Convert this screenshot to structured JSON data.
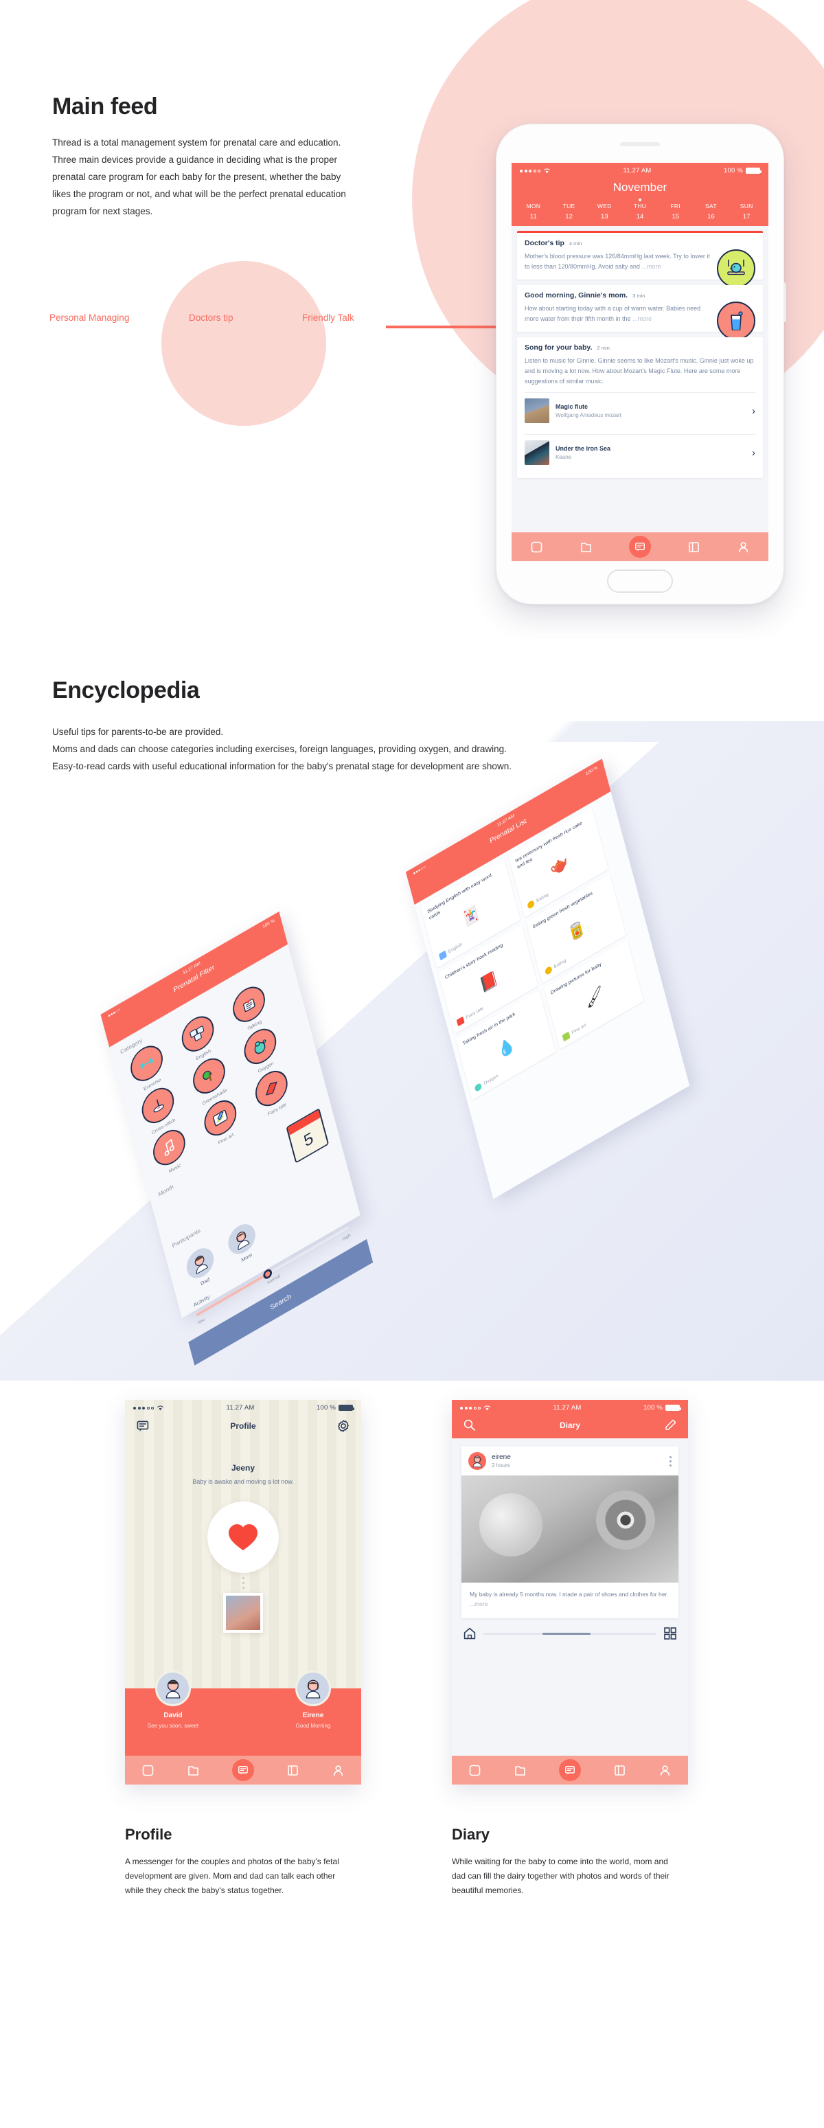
{
  "sections": {
    "main": {
      "title": "Main feed",
      "paragraph": "Thread is a total management system for prenatal care and education.\nThree main devices provide a guidance in deciding what is the proper\nprenatal care program for each baby for the present, whether the baby\n likes the program or not, and what will be the perfect prenatal education\nprogram for next stages.",
      "tags": [
        "Personal Managing",
        "Doctors tip",
        "Friendly Talk"
      ]
    },
    "encyclopedia": {
      "title": "Encyclopedia",
      "lines": [
        "Useful tips for parents-to-be are provided.",
        "Moms and dads can choose categories including exercises, foreign languages, providing oxygen, and drawing.",
        "Easy-to-read cards with useful educational information for the baby's prenatal stage for development are shown."
      ]
    },
    "profile": {
      "title": "Profile",
      "body": "A messenger for the couples and photos of the baby's fetal development are given. Mom and dad can talk each other while they check the baby's status together."
    },
    "diary": {
      "title": "Diary",
      "body": "While waiting for the baby to come into the world, mom and dad can fill the dairy together with photos and words of their beautiful memories."
    }
  },
  "status_bar": {
    "time": "11.27 AM",
    "battery": "100 %"
  },
  "feed_screen": {
    "month": "November",
    "days": [
      {
        "name": "MON",
        "date": "11"
      },
      {
        "name": "TUE",
        "date": "12"
      },
      {
        "name": "WED",
        "date": "13"
      },
      {
        "name": "THU",
        "date": "14"
      },
      {
        "name": "FRI",
        "date": "15"
      },
      {
        "name": "SAT",
        "date": "16"
      },
      {
        "name": "SUN",
        "date": "17"
      }
    ],
    "cards": [
      {
        "title": "Doctor's tip",
        "meta": "4 min",
        "body": "Mother's blood pressure was 126/84mmHg last week. Try to lower it to less than 120/80mmHg. Avoid salty and ",
        "more": "...more",
        "icon": "bird-swing-icon"
      },
      {
        "title": "Good morning, Ginnie's mom.",
        "meta": "3 min",
        "body": "How about starting today with a cup of warm water. Babies need more water from their fifth month in the ",
        "more": "...more",
        "icon": "water-glass-icon"
      },
      {
        "title": "Song for your baby.",
        "meta": "2 min",
        "body": "Listen to music for Ginnie. Ginnie seems to like Mozart's music. Ginnie just woke up and is moving a lot now. How about Mozart's Magic Flute. Here are some more suggestions of similar music.",
        "songs": [
          {
            "title": "Magic flute",
            "artist": "Wolfgang Amadeus mozart"
          },
          {
            "title": "Under the Iron Sea",
            "artist": "Keane"
          }
        ]
      }
    ],
    "tabs": [
      "note-tab",
      "folder-tab",
      "chat-tab",
      "book-tab",
      "person-tab"
    ]
  },
  "iso": {
    "filter_screen": {
      "title": "Prenatal Filter",
      "category_label": "Category",
      "categories": [
        {
          "name": "Exercise",
          "icon": "dumbbell-icon",
          "glyph": "🏋"
        },
        {
          "name": "English",
          "icon": "abc-cards-icon",
          "glyph": "🔤"
        },
        {
          "name": "Talking",
          "icon": "book-heart-icon",
          "glyph": "📖"
        },
        {
          "name": "Cross-stitch",
          "icon": "needle-icon",
          "glyph": "🧵"
        },
        {
          "name": "Greenshade",
          "icon": "tree-icon",
          "glyph": "🌳"
        },
        {
          "name": "Oxygen",
          "icon": "bubble-icon",
          "glyph": "💧"
        },
        {
          "name": "Music",
          "icon": "music-note-icon",
          "glyph": "🎵"
        },
        {
          "name": "Fine art",
          "icon": "pen-tablet-icon",
          "glyph": "🖊"
        },
        {
          "name": "Fairy tale",
          "icon": "red-book-icon",
          "glyph": "📕"
        }
      ],
      "month_label": "Month",
      "month_value": "5",
      "participants_label": "Participants",
      "participants": [
        {
          "name": "Dad",
          "icon": "dad-avatar"
        },
        {
          "name": "Mom",
          "icon": "mom-avatar"
        }
      ],
      "activity_label": "Activity",
      "activity_ticks": [
        "low",
        "normal",
        "high"
      ],
      "activity_value": "normal",
      "search_label": "Search"
    },
    "list_screen": {
      "title": "Prenatal List",
      "cards": [
        {
          "title": "Studying English with easy word cards",
          "tag": "English",
          "icon": "word-cards-icon",
          "glyph": "🃏"
        },
        {
          "title": "tea ceremony with fresh rice cake and tea",
          "tag": "Eating",
          "icon": "teapot-icon",
          "glyph": "🫖"
        },
        {
          "title": "Children's story book reading",
          "tag": "Fairy tale",
          "icon": "red-book-icon",
          "glyph": "📕"
        },
        {
          "title": "Eating green fresh vegetables",
          "tag": "Eating",
          "icon": "vegetables-icon",
          "glyph": "🥬"
        },
        {
          "title": "Taking fresh air in the park",
          "tag": "Oxygen",
          "icon": "bubble-icon",
          "glyph": "💧"
        },
        {
          "title": "Drawing pictures for baby",
          "tag": "Fine art",
          "icon": "pen-tablet-icon",
          "glyph": "🖊"
        }
      ]
    }
  },
  "profile_screen": {
    "title": "Profile",
    "baby_name": "Jeeny",
    "baby_status": "Baby is awake and moving a lot now.",
    "people": [
      {
        "name": "David",
        "message": "See you soon, sweet",
        "icon": "dad-avatar"
      },
      {
        "name": "Eirene",
        "message": "Good Morning",
        "icon": "mom-avatar"
      }
    ]
  },
  "diary_screen": {
    "title": "Diary",
    "post": {
      "user": "eirene",
      "time": "2 hours",
      "caption": "My baby is already 5 months now. I made a pair of shoes and clothes for her. ",
      "more": "...more"
    }
  },
  "colors": {
    "coral": "#f96a5d",
    "coral_light": "#f8a093",
    "blush": "#fbd7d2",
    "navy": "#1f2d4d",
    "lavender": "#e4e8f5",
    "search_blue": "#6f86b8"
  }
}
